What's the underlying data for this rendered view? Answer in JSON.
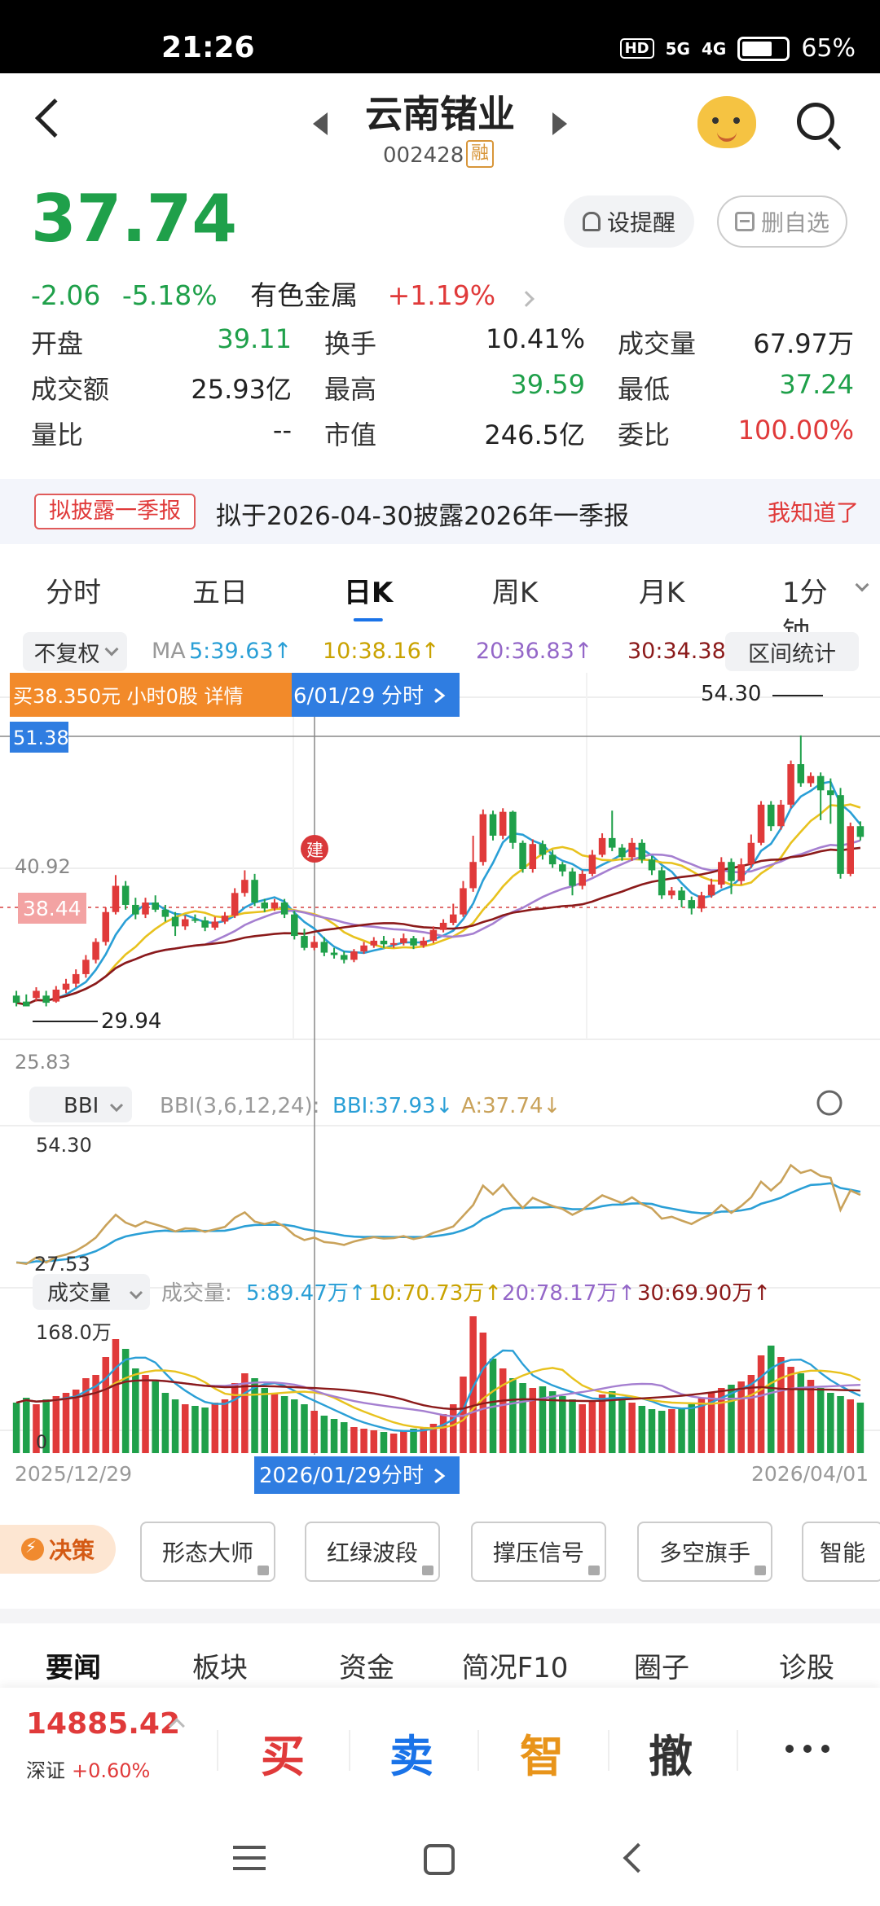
{
  "status_bar": {
    "time": "21:26",
    "network_hd": "HD",
    "signal_5g": "5G",
    "signal_4g": "4G",
    "battery": "65%"
  },
  "header": {
    "title": "云南锗业",
    "code": "002428",
    "margin_badge": "融"
  },
  "quote": {
    "price": "37.74",
    "change": "-2.06",
    "change_pct": "-5.18%",
    "sector": "有色金属",
    "sector_change": "+1.19%",
    "alert_label": "设提醒",
    "unfav_label": "删自选"
  },
  "stats": [
    [
      {
        "label": "开盘",
        "value": "39.11",
        "color": "#1fa04a"
      },
      {
        "label": "换手",
        "value": "10.41%",
        "color": "#222"
      },
      {
        "label": "成交量",
        "value": "67.97万",
        "color": "#222"
      }
    ],
    [
      {
        "label": "成交额",
        "value": "25.93亿",
        "color": "#222"
      },
      {
        "label": "最高",
        "value": "39.59",
        "color": "#1fa04a"
      },
      {
        "label": "最低",
        "value": "37.24",
        "color": "#1fa04a"
      }
    ],
    [
      {
        "label": "量比",
        "value": "--",
        "color": "#222"
      },
      {
        "label": "市值",
        "value": "246.5亿",
        "color": "#222"
      },
      {
        "label": "委比",
        "value": "100.00%",
        "color": "#e03a3a"
      }
    ]
  ],
  "notice": {
    "tag": "拟披露一季报",
    "text": "拟于2026-04-30披露2026年一季报",
    "ack": "我知道了"
  },
  "period_tabs": [
    "分时",
    "五日",
    "日K",
    "周K",
    "月K",
    "1分钟"
  ],
  "active_period": 2,
  "ma_row": {
    "adjust": "不复权",
    "ma_label": "MA",
    "ma5": "5:39.63↑",
    "ma10": "10:38.16↑",
    "ma20": "20:36.83↑",
    "ma30": "30:34.38↑",
    "range_stat": "区间统计"
  },
  "colors": {
    "up": "#e03a3a",
    "down": "#1fa04a",
    "ma5": "#2a9fd6",
    "ma10": "#e8c21e",
    "ma20": "#a57fd0",
    "ma30": "#8b1a1a",
    "accent": "#1a73e8"
  },
  "kline": {
    "tooltip_buy": "买38.350元 小时0股 详情",
    "tooltip_date": "6/01/29",
    "tooltip_fenshi": "分时",
    "cursor_price": "51.38",
    "last_price_tag": "38.44",
    "high_label": "54.30",
    "low_label": "29.94",
    "axis_top": "40.92",
    "axis_bottom": "25.83",
    "jian_badge": "建"
  },
  "bbi": {
    "selector": "BBI",
    "params": "BBI(3,6,12,24):",
    "bbi_value": "BBI:37.93↓",
    "a_value": "A:37.74↓",
    "axis_top": "54.30",
    "axis_bottom": "27.53"
  },
  "volume": {
    "selector": "成交量",
    "label": "成交量:",
    "v5": "5:89.47万↑",
    "v10": "10:70.73万↑",
    "v20": "20:78.17万↑",
    "v30": "30:69.90万↑",
    "axis_top": "168.0万",
    "axis_zero": "0"
  },
  "date_axis": {
    "start": "2025/12/29",
    "cursor": "2026/01/29",
    "cursor_fenshi": "分时",
    "end": "2026/04/01"
  },
  "chart_data": {
    "type": "candlestick",
    "series": [
      {
        "name": "K",
        "candles": [
          [
            30.8,
            30.2,
            31.2,
            29.9
          ],
          [
            30.3,
            29.9,
            30.9,
            29.9
          ],
          [
            30.6,
            31.2,
            31.5,
            30.3
          ],
          [
            30.8,
            30.2,
            31.2,
            29.9
          ],
          [
            30.3,
            31.3,
            31.6,
            30.2
          ],
          [
            31.3,
            31.8,
            32.2,
            31.0
          ],
          [
            31.8,
            32.6,
            33.0,
            31.5
          ],
          [
            32.6,
            33.8,
            34.2,
            32.3
          ],
          [
            33.8,
            35.3,
            35.6,
            33.5
          ],
          [
            35.3,
            37.8,
            38.2,
            35.0
          ],
          [
            37.8,
            40.0,
            40.9,
            37.6
          ],
          [
            40.0,
            38.4,
            40.4,
            38.0
          ],
          [
            38.4,
            37.6,
            39.0,
            37.2
          ],
          [
            37.6,
            38.6,
            39.0,
            37.3
          ],
          [
            38.6,
            38.0,
            39.2,
            37.8
          ],
          [
            38.0,
            37.4,
            38.4,
            37.0
          ],
          [
            37.4,
            36.6,
            37.8,
            35.8
          ],
          [
            36.6,
            37.2,
            37.5,
            36.3
          ],
          [
            37.2,
            37.1,
            37.6,
            36.9
          ],
          [
            37.1,
            36.5,
            37.4,
            36.2
          ],
          [
            36.5,
            37.0,
            37.4,
            36.3
          ],
          [
            37.0,
            37.5,
            37.8,
            36.8
          ],
          [
            37.5,
            39.4,
            39.8,
            37.3
          ],
          [
            39.4,
            40.5,
            41.3,
            39.1
          ],
          [
            40.5,
            38.6,
            41.0,
            38.3
          ],
          [
            38.6,
            38.1,
            38.9,
            37.8
          ],
          [
            38.1,
            38.6,
            38.9,
            37.9
          ],
          [
            38.6,
            37.6,
            38.9,
            37.3
          ],
          [
            37.6,
            35.8,
            37.9,
            35.5
          ],
          [
            35.8,
            34.8,
            36.4,
            34.6
          ],
          [
            34.8,
            35.3,
            35.8,
            34.6
          ],
          [
            35.3,
            34.4,
            35.7,
            34.1
          ],
          [
            34.4,
            34.2,
            34.8,
            33.9
          ],
          [
            34.2,
            33.8,
            34.5,
            33.5
          ],
          [
            33.8,
            34.5,
            34.7,
            33.6
          ],
          [
            34.5,
            35.0,
            35.3,
            34.3
          ],
          [
            35.0,
            35.4,
            35.7,
            34.8
          ],
          [
            35.4,
            35.1,
            35.8,
            34.8
          ],
          [
            35.1,
            35.2,
            35.6,
            34.8
          ],
          [
            35.2,
            35.6,
            36.0,
            35.0
          ],
          [
            35.6,
            35.0,
            35.8,
            34.7
          ],
          [
            35.0,
            35.4,
            35.7,
            34.8
          ],
          [
            35.4,
            36.3,
            36.6,
            35.2
          ],
          [
            36.3,
            36.9,
            37.2,
            36.1
          ],
          [
            36.9,
            37.6,
            38.5,
            36.7
          ],
          [
            37.6,
            39.8,
            40.4,
            37.4
          ],
          [
            39.8,
            42.0,
            44.2,
            39.5
          ],
          [
            42.0,
            46.0,
            46.4,
            41.7
          ],
          [
            46.0,
            44.2,
            46.3,
            43.8
          ],
          [
            44.2,
            46.2,
            46.5,
            43.9
          ],
          [
            46.2,
            43.6,
            46.3,
            43.1
          ],
          [
            43.6,
            41.4,
            43.8,
            41.1
          ],
          [
            41.4,
            43.5,
            43.9,
            41.1
          ],
          [
            43.5,
            42.6,
            43.8,
            42.2
          ],
          [
            42.6,
            41.8,
            43.0,
            41.5
          ],
          [
            41.8,
            41.2,
            42.0,
            40.8
          ],
          [
            41.2,
            40.0,
            41.5,
            39.2
          ],
          [
            40.0,
            41.0,
            41.3,
            39.7
          ],
          [
            41.0,
            42.6,
            43.0,
            40.8
          ],
          [
            42.6,
            44.0,
            44.4,
            42.4
          ],
          [
            44.0,
            43.2,
            46.3,
            42.9
          ],
          [
            43.2,
            42.4,
            43.5,
            42.1
          ],
          [
            42.4,
            43.6,
            44.0,
            42.1
          ],
          [
            43.6,
            42.2,
            43.9,
            41.9
          ],
          [
            42.2,
            41.3,
            42.5,
            40.9
          ],
          [
            41.3,
            39.2,
            41.6,
            38.9
          ],
          [
            39.2,
            39.6,
            39.9,
            38.9
          ],
          [
            39.6,
            38.8,
            39.9,
            38.2
          ],
          [
            38.8,
            38.1,
            39.1,
            37.6
          ],
          [
            38.1,
            39.2,
            39.5,
            37.8
          ],
          [
            39.2,
            40.1,
            40.6,
            39.0
          ],
          [
            40.1,
            42.0,
            42.4,
            39.8
          ],
          [
            42.0,
            40.4,
            42.3,
            39.3
          ],
          [
            40.4,
            41.8,
            42.3,
            40.1
          ],
          [
            41.8,
            43.6,
            44.3,
            41.5
          ],
          [
            43.6,
            46.8,
            47.1,
            43.4
          ],
          [
            46.8,
            45.0,
            47.1,
            44.6
          ],
          [
            45.0,
            46.8,
            47.2,
            44.7
          ],
          [
            46.8,
            50.2,
            50.5,
            46.5
          ],
          [
            50.2,
            48.6,
            52.6,
            48.3
          ],
          [
            48.6,
            49.2,
            49.5,
            48.3
          ],
          [
            49.2,
            48.0,
            49.5,
            45.5
          ],
          [
            48.0,
            47.6,
            49.0,
            45.2
          ],
          [
            47.6,
            41.0,
            48.2,
            40.6
          ],
          [
            41.0,
            45.0,
            45.3,
            40.8
          ],
          [
            45.0,
            44.1,
            45.4,
            43.8
          ]
        ]
      }
    ],
    "x_start": "2025/12/29",
    "x_end": "2026/04/01",
    "y_labels": {
      "top": "40.92",
      "bottom": "25.83"
    },
    "volume": [
      62,
      68,
      60,
      66,
      70,
      74,
      78,
      92,
      96,
      118,
      140,
      128,
      104,
      96,
      88,
      74,
      66,
      60,
      58,
      56,
      62,
      66,
      86,
      98,
      92,
      80,
      74,
      70,
      66,
      60,
      52,
      46,
      42,
      38,
      32,
      30,
      28,
      26,
      24,
      28,
      30,
      32,
      36,
      48,
      60,
      94,
      168,
      148,
      116,
      104,
      92,
      86,
      80,
      82,
      76,
      70,
      66,
      60,
      64,
      72,
      76,
      68,
      62,
      58,
      54,
      52,
      54,
      56,
      60,
      68,
      74,
      80,
      84,
      88,
      96,
      120,
      132,
      118,
      106,
      98,
      90,
      80,
      74,
      70,
      66,
      62
    ]
  },
  "indicator_strip": {
    "decision": "决策",
    "buttons": [
      "形态大师",
      "红绿波段",
      "撑压信号",
      "多空旗手",
      "智能"
    ]
  },
  "news_tabs": [
    "要闻",
    "板块",
    "资金",
    "简况F10",
    "圈子",
    "诊股"
  ],
  "bottom_bar": {
    "index_value": "14885.42",
    "index_name": "深证",
    "index_change": "+0.60%",
    "buy": "买",
    "sell": "卖",
    "smart": "智",
    "cancel": "撤"
  }
}
